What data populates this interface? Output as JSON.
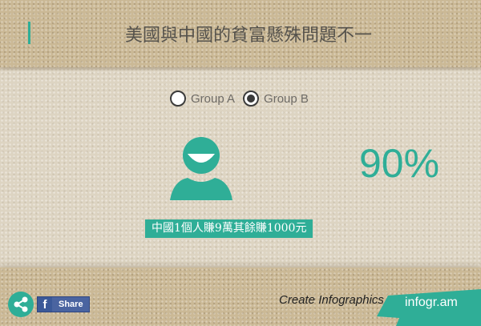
{
  "header": {
    "title": "美國與中國的貧富懸殊問題不一"
  },
  "group_selector": {
    "options": [
      {
        "label": "Group A",
        "selected": false
      },
      {
        "label": "Group B",
        "selected": true
      }
    ]
  },
  "stat": {
    "icon": "person-icon",
    "value": "90%",
    "caption": "中國1個人賺9萬其餘賺1000元"
  },
  "footer": {
    "share_icon": "share-icon",
    "facebook_logo": "f",
    "facebook_label": "Share",
    "create_text": "Create Infographics",
    "brand": "infogr.am"
  },
  "colors": {
    "accent": "#2fae97",
    "facebook": "#4a64a0"
  }
}
